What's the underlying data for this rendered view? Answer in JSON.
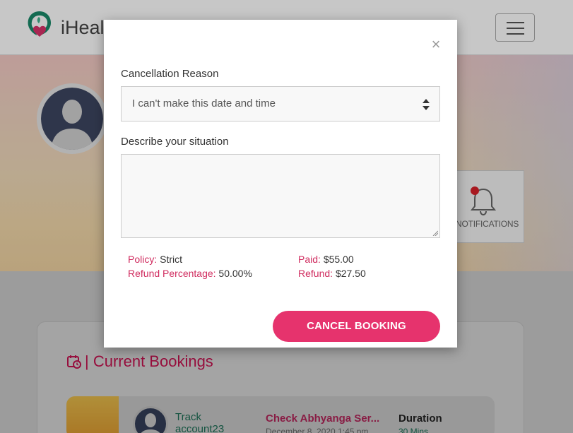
{
  "navbar": {
    "brand": "iHeal"
  },
  "profile": {
    "notifications_label": "NOTIFICATIONS"
  },
  "bookings": {
    "title": "| Current Bookings",
    "rows": [
      {
        "name": "Track account23",
        "service": "Check Abhyanga Ser...",
        "date": "December 8, 2020 1:45 pm",
        "duration_label": "Duration",
        "duration_value": "30 Mins"
      }
    ]
  },
  "modal": {
    "close_symbol": "×",
    "reason_label": "Cancellation Reason",
    "reason_selected": "I can't make this date and time",
    "describe_label": "Describe your situation",
    "describe_value": "",
    "policy_key": "Policy:",
    "policy_value": "Strict",
    "refund_pct_key": "Refund Percentage:",
    "refund_pct_value": "50.00%",
    "paid_key": "Paid:",
    "paid_value": "$55.00",
    "refund_key": "Refund:",
    "refund_value": "$27.50",
    "cancel_button": "CANCEL BOOKING"
  },
  "colors": {
    "accent": "#e6336d",
    "key_text": "#d02c5f",
    "teal": "#1a6b52"
  }
}
